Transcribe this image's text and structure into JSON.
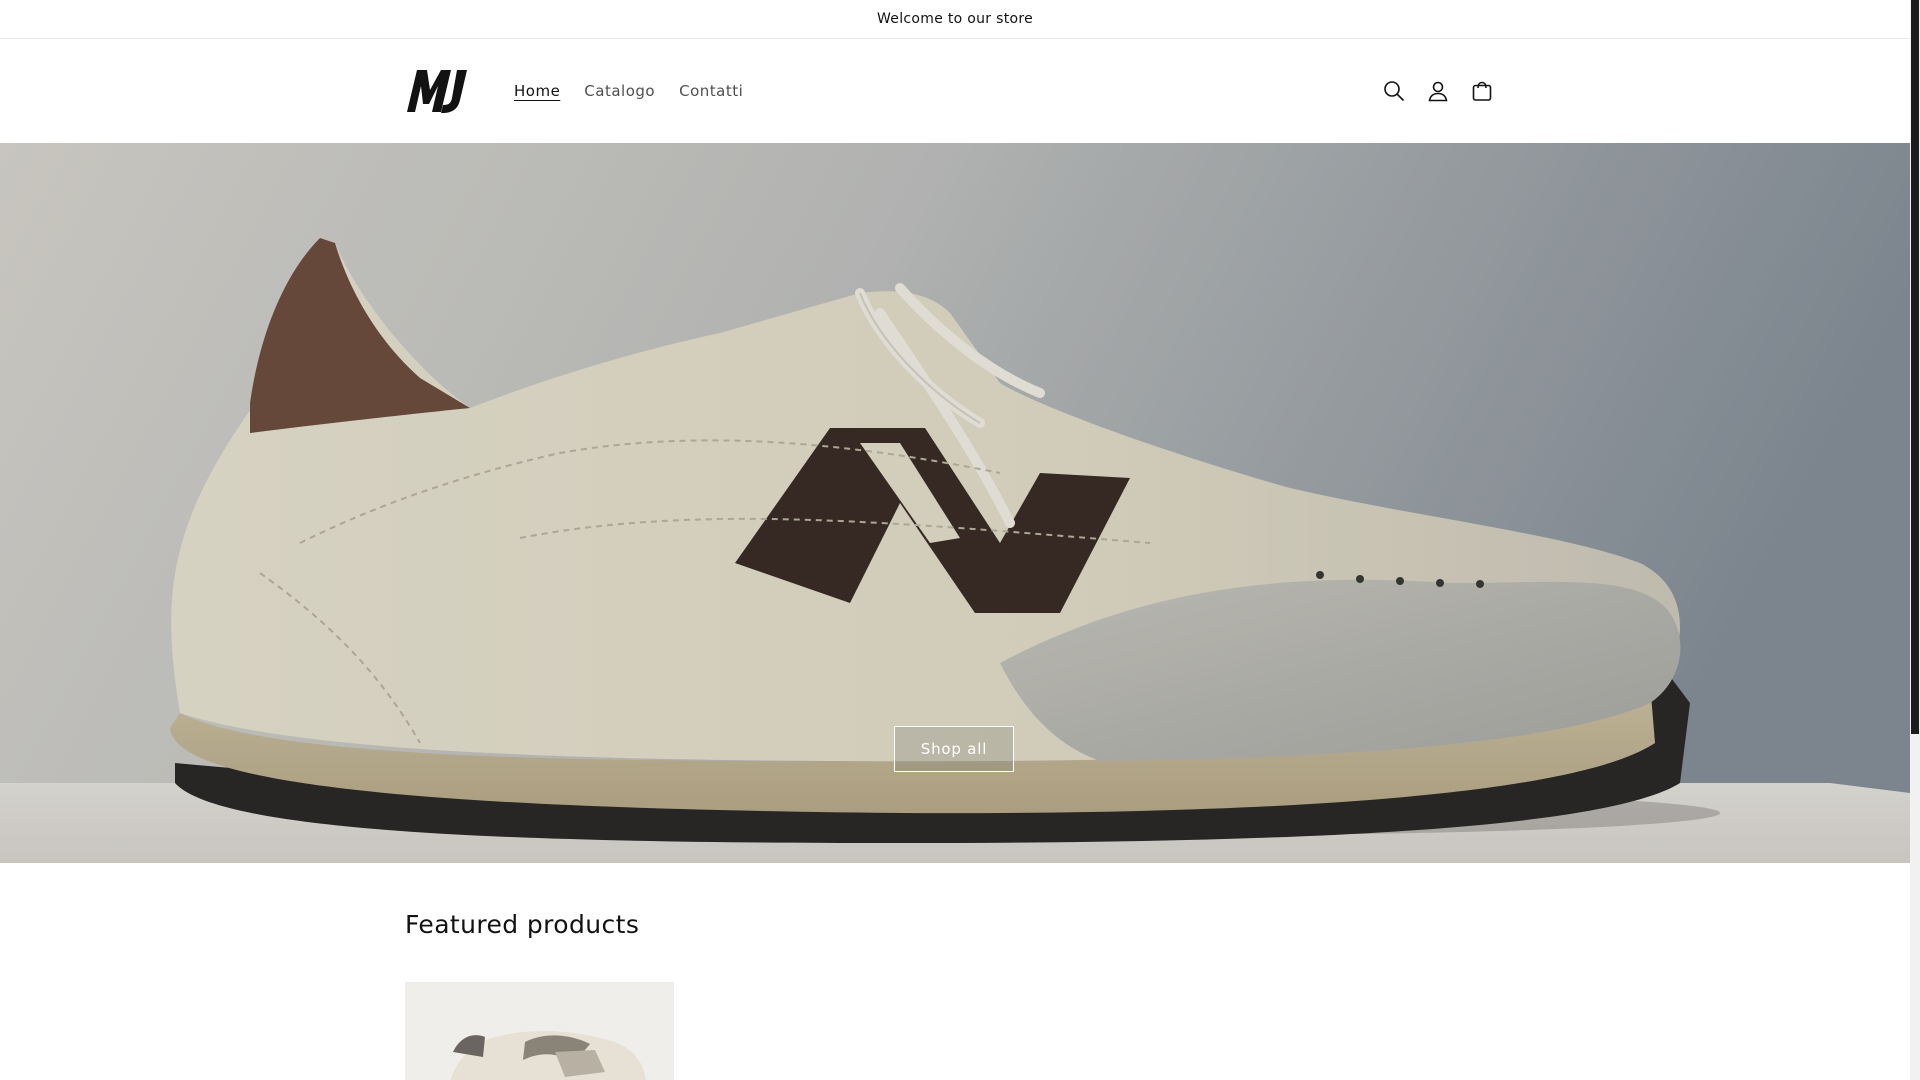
{
  "announcement": {
    "text": "Welcome to our store"
  },
  "header": {
    "logo_text": "MJ",
    "nav": [
      {
        "label": "Home",
        "active": true
      },
      {
        "label": "Catalogo",
        "active": false
      },
      {
        "label": "Contatti",
        "active": false
      }
    ],
    "icons": [
      "search-icon",
      "account-icon",
      "cart-icon"
    ]
  },
  "hero": {
    "button_label": "Shop all"
  },
  "featured": {
    "title": "Featured products"
  },
  "colors": {
    "text": "#121212",
    "background": "#ffffff",
    "scrollbar_thumb": "#1c1c1c"
  }
}
